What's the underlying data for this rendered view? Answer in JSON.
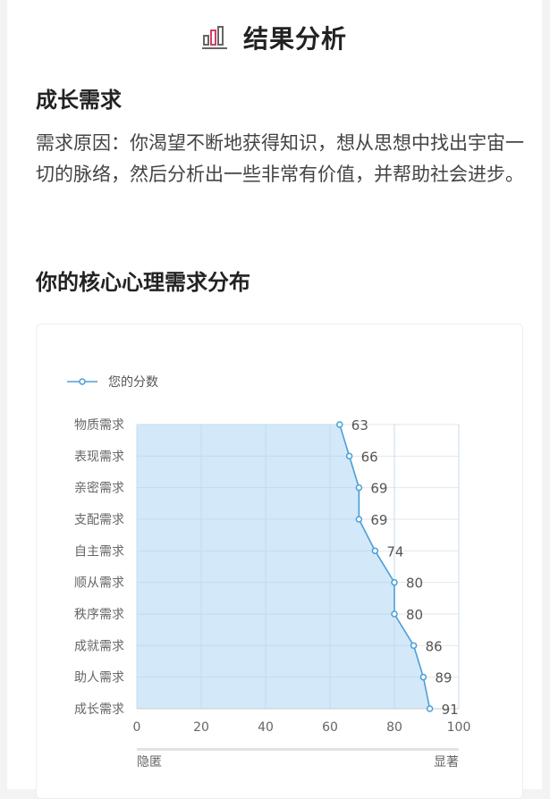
{
  "header": {
    "title": "结果分析",
    "icon": "bar-chart-icon"
  },
  "result": {
    "title": "成长需求",
    "description": "需求原因：你渴望不断地获得知识，想从思想中找出宇宙一切的脉络，然后分析出一些非常有价值，并帮助社会进步。"
  },
  "distribution_title": "你的核心心理需求分布",
  "chart_data": {
    "type": "area",
    "orientation": "horizontal",
    "categories": [
      "物质需求",
      "表现需求",
      "亲密需求",
      "支配需求",
      "自主需求",
      "顺从需求",
      "秩序需求",
      "成就需求",
      "助人需求",
      "成长需求"
    ],
    "series": [
      {
        "name": "您的分数",
        "values": [
          63,
          66,
          69,
          69,
          74,
          80,
          80,
          86,
          89,
          91
        ]
      }
    ],
    "xlim": [
      0,
      100
    ],
    "xticks": [
      0,
      20,
      40,
      60,
      80,
      100
    ],
    "xaxis_left_label": "隐匿",
    "xaxis_right_label": "显著",
    "legend_position": "top-left",
    "grid": true,
    "line_color": "#4a9fd8",
    "fill_color": "#d3e8f8"
  }
}
